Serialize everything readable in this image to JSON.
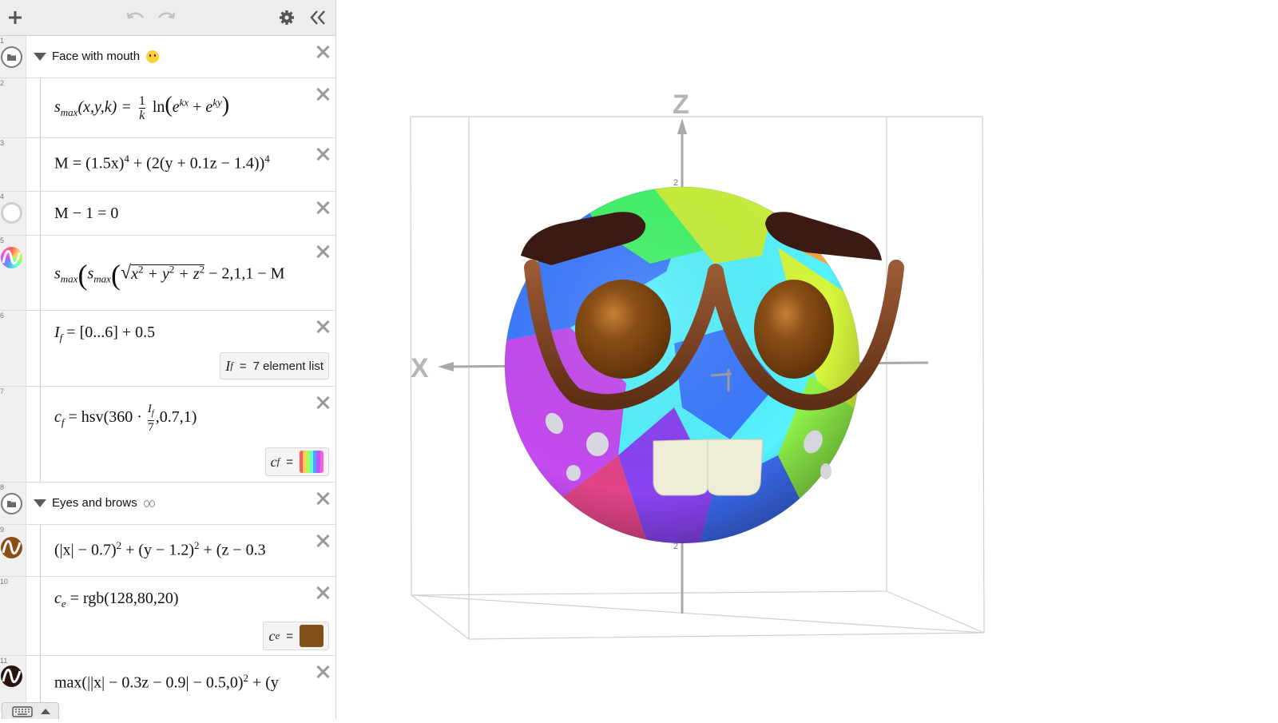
{
  "toolbar": {
    "add_icon": "plus-icon",
    "undo_icon": "undo-icon",
    "redo_icon": "redo-icon",
    "settings_icon": "gear-icon",
    "collapse_icon": "double-chevron-left-icon"
  },
  "expressions": [
    {
      "num": "1",
      "type": "folder",
      "title": "Face with mouth",
      "emoji": "😶"
    },
    {
      "num": "2",
      "latex": "s_max(x,y,k) = 1/k ln(e^kx + e^ky)"
    },
    {
      "num": "3",
      "latex": "M = (1.5x)^4 + (2(y + 0.1z − 1.4))^4"
    },
    {
      "num": "4",
      "latex": "M − 1 = 0"
    },
    {
      "num": "5",
      "latex": "s_max(s_max(√(x² + y² + z²) − 2,1,1 − M"
    },
    {
      "num": "6",
      "latex": "I_f = [0...6] + 0.5",
      "badge_label": "I",
      "badge_sub": "f",
      "badge_eq": "=",
      "badge_value": "7 element list"
    },
    {
      "num": "7",
      "latex": "c_f = hsv(360 · I_f/7,0.7,1)",
      "badge_label": "c",
      "badge_sub": "f",
      "badge_eq": "="
    },
    {
      "num": "8",
      "type": "folder",
      "title": "Eyes and brows",
      "emoji": "👀"
    },
    {
      "num": "9",
      "latex": "(|x| − 0.7)² + (y − 1.2)² + (z − 0.3"
    },
    {
      "num": "10",
      "latex": "c_e = rgb(128,80,20)",
      "badge_label": "c",
      "badge_sub": "e",
      "badge_eq": "="
    },
    {
      "num": "11",
      "latex": "max(||x| − 0.3z − 0.9| − 0.5,0)² + (y"
    }
  ],
  "text": {
    "e1_title": "Face with mouth",
    "e2_lhs": "s",
    "e2_sub": "max",
    "e2_args": "(x,y,k) =",
    "e2_num": "1",
    "e2_den": "k",
    "e2_ln": "ln",
    "e2_e": "e",
    "e2_kx": "kx",
    "e2_plus": "+",
    "e2_ky": "ky",
    "e3_a": "M = (1.5x)",
    "e3_p1": "4",
    "e3_b": "+ (2(y + 0.1z − 1.4))",
    "e3_p2": "4",
    "e4": "M − 1 = 0",
    "e5_s": "s",
    "e5_sub": "max",
    "e5_rad": "x",
    "e5_rest": "+ y",
    "e5_rest2": "+ z",
    "e5_tail": "− 2,1,1 − M",
    "sq": "2",
    "e6_a": "I",
    "e6_sub": "f",
    "e6_b": "= [0...6] + 0.5",
    "e7_a": "c",
    "e7_sub": "f",
    "e7_b": "= hsv(",
    "e7_c": "360 ·",
    "e7_frac_num": "I",
    "e7_frac_num_sub": "f",
    "e7_frac_den": "7",
    "e7_d": ",0.7,1)",
    "e8_title": "Eyes and brows",
    "e9_a": "(|x| − 0.7)",
    "e9_b": "+ (y − 1.2)",
    "e9_c": "+ (z − 0.3",
    "e10_a": "c",
    "e10_sub": "e",
    "e10_b": "= rgb(128,80,20)",
    "e11_a": "max(||x| − 0.3z − 0.9| − 0.5,0)",
    "e11_b": "+ (y"
  },
  "colors": {
    "swatch_ce": "#80501a",
    "palette_cf": [
      "#ff5c5c",
      "#ffd15c",
      "#9cff5c",
      "#5cffcc",
      "#5c9cff",
      "#b05cff",
      "#ff5cd6"
    ],
    "brown": "#6b3b1c",
    "icon_e9": "#8a4f17",
    "icon_e11": "#2a1410"
  },
  "graph": {
    "axis_x": "X",
    "axis_z": "Z",
    "tick_top": "2",
    "tick_bottom": "2"
  }
}
